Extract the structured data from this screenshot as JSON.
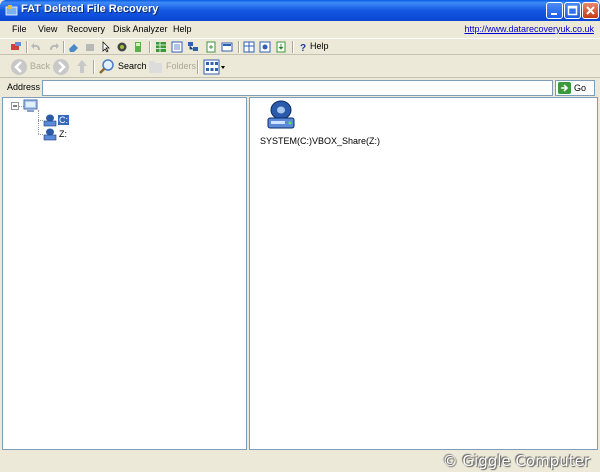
{
  "window": {
    "title": "FAT Deleted File Recovery"
  },
  "menu": {
    "items": [
      "File",
      "View",
      "Recovery",
      "Disk Analyzer",
      "Help"
    ],
    "url": "http://www.datarecoveryuk.co.uk"
  },
  "toolbar": {
    "help_label": "Help"
  },
  "nav": {
    "back_label": "Back",
    "search_label": "Search",
    "folders_label": "Folders"
  },
  "address": {
    "label": "Address",
    "value": "",
    "go_label": "Go"
  },
  "tree": {
    "items": [
      {
        "label": "C:",
        "selected": true
      },
      {
        "label": "Z:",
        "selected": false
      }
    ]
  },
  "drives": [
    {
      "label": "SYSTEM(C:)",
      "icon": "hard-drive-icon"
    },
    {
      "label": "VBOX_Share(Z:)",
      "icon": "none"
    }
  ],
  "watermark": "© Giggle Computer",
  "colors": {
    "titlebar": "#0a5be0",
    "selection": "#316ac5",
    "link": "#0000cc"
  }
}
